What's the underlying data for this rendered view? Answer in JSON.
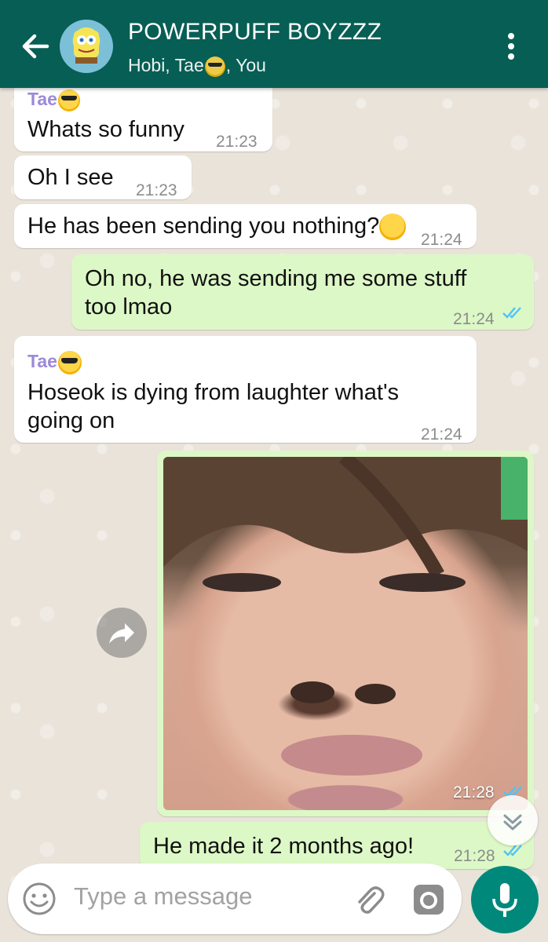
{
  "header": {
    "title": "POWERPUFF BOYZZZ",
    "subtitle_before": "Hobi, Tae",
    "subtitle_after": ", You"
  },
  "messages": [
    {
      "sender": "Tae",
      "text": "Whats so funny",
      "time": "21:23"
    },
    {
      "text": "Oh I see",
      "time": "21:23"
    },
    {
      "text": "He has been sending you nothing?",
      "time": "21:24"
    },
    {
      "text_line1": "Oh no, he was sending me some stuff",
      "text_line2": "too lmao",
      "time": "21:24"
    },
    {
      "sender": "Tae",
      "text_line1": "Hoseok is dying from laughter what's",
      "text_line2": "going on",
      "time": "21:24"
    },
    {
      "image_time": "21:28"
    },
    {
      "text": "He made it 2 months ago!",
      "time": "21:28"
    }
  ],
  "input": {
    "placeholder": "Type a message"
  },
  "colors": {
    "header": "#075e54",
    "outgoing": "#dcf8c6",
    "incoming": "#ffffff",
    "accent": "#00897b",
    "read_ticks": "#4fc3f7"
  },
  "icons": [
    "back-arrow-icon",
    "more-vert-icon",
    "forward-icon",
    "scroll-down-icon",
    "emoji-icon",
    "attach-icon",
    "camera-icon",
    "mic-icon"
  ]
}
